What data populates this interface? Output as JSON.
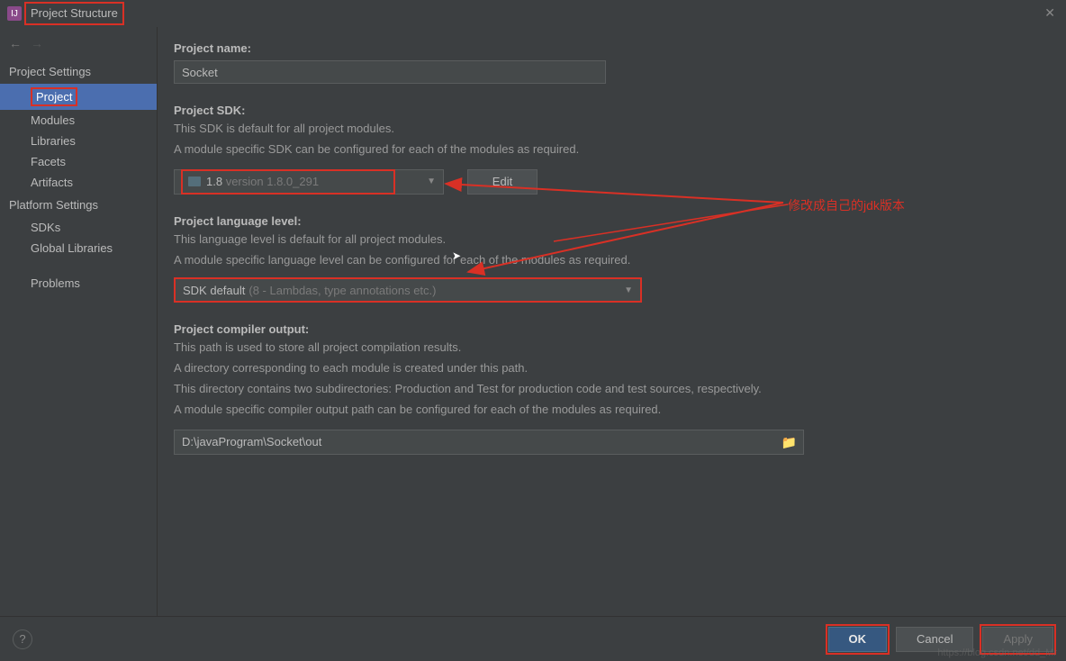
{
  "window": {
    "title": "Project Structure"
  },
  "sidebar": {
    "section1": "Project Settings",
    "items1": [
      "Project",
      "Modules",
      "Libraries",
      "Facets",
      "Artifacts"
    ],
    "section2": "Platform Settings",
    "items2": [
      "SDKs",
      "Global Libraries"
    ],
    "section3": "Problems"
  },
  "project": {
    "name_label": "Project name:",
    "name_value": "Socket",
    "sdk_label": "Project SDK:",
    "sdk_help1": "This SDK is default for all project modules.",
    "sdk_help2": "A module specific SDK can be configured for each of the modules as required.",
    "sdk_value_main": "1.8",
    "sdk_value_sub": "version 1.8.0_291",
    "edit_label": "Edit",
    "lang_label": "Project language level:",
    "lang_help1": "This language level is default for all project modules.",
    "lang_help2": "A module specific language level can be configured for each of the modules as required.",
    "lang_value_main": "SDK default",
    "lang_value_sub": "(8 - Lambdas, type annotations etc.)",
    "output_label": "Project compiler output:",
    "output_help1": "This path is used to store all project compilation results.",
    "output_help2": "A directory corresponding to each module is created under this path.",
    "output_help3": "This directory contains two subdirectories: Production and Test for production code and test sources, respectively.",
    "output_help4": "A module specific compiler output path can be configured for each of the modules as required.",
    "output_value": "D:\\javaProgram\\Socket\\out"
  },
  "annotation": {
    "text": "修改成自己的jdk版本"
  },
  "footer": {
    "ok": "OK",
    "cancel": "Cancel",
    "apply": "Apply"
  },
  "watermark": "https://blog.csdn.net/dd_Mr"
}
